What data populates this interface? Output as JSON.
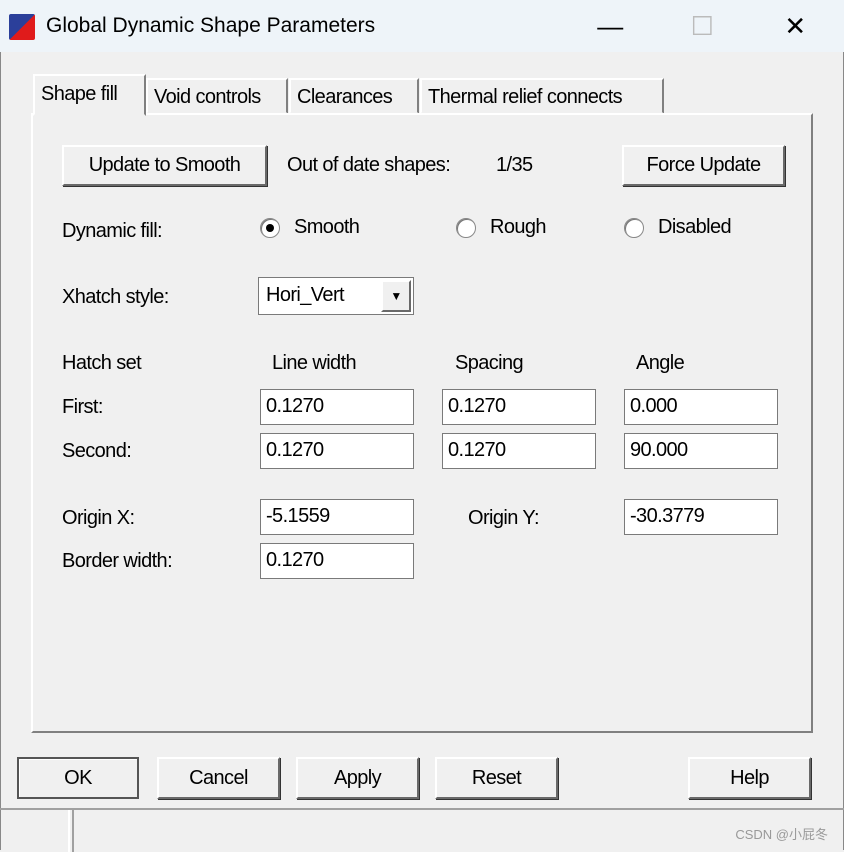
{
  "window": {
    "title": "Global Dynamic Shape Parameters",
    "minimize": "—",
    "maximize": "☐",
    "close": "✕"
  },
  "tabs": [
    {
      "label": "Shape fill",
      "active": true
    },
    {
      "label": "Void controls"
    },
    {
      "label": "Clearances"
    },
    {
      "label": "Thermal relief connects"
    }
  ],
  "shape_fill": {
    "update_button": "Update to Smooth",
    "out_of_date_label": "Out of date shapes:",
    "out_of_date_value": "1/35",
    "force_update_button": "Force Update",
    "dynamic_fill_label": "Dynamic fill:",
    "dynamic_fill_options": [
      {
        "label": "Smooth",
        "selected": true
      },
      {
        "label": "Rough",
        "selected": false
      },
      {
        "label": "Disabled",
        "selected": false
      }
    ],
    "xhatch_label": "Xhatch style:",
    "xhatch_value": "Hori_Vert",
    "hatch_headers": [
      "Hatch set",
      "Line width",
      "Spacing",
      "Angle"
    ],
    "hatch_rows": [
      {
        "label": "First:",
        "line_width": "0.1270",
        "spacing": "0.1270",
        "angle": "0.000"
      },
      {
        "label": "Second:",
        "line_width": "0.1270",
        "spacing": "0.1270",
        "angle": "90.000"
      }
    ],
    "origin_x_label": "Origin X:",
    "origin_x": "-5.1559",
    "origin_y_label": "Origin Y:",
    "origin_y": "-30.3779",
    "border_width_label": "Border width:",
    "border_width": "0.1270"
  },
  "buttons": {
    "ok": "OK",
    "cancel": "Cancel",
    "apply": "Apply",
    "reset": "Reset",
    "help": "Help"
  },
  "watermark": "CSDN @小屁冬"
}
